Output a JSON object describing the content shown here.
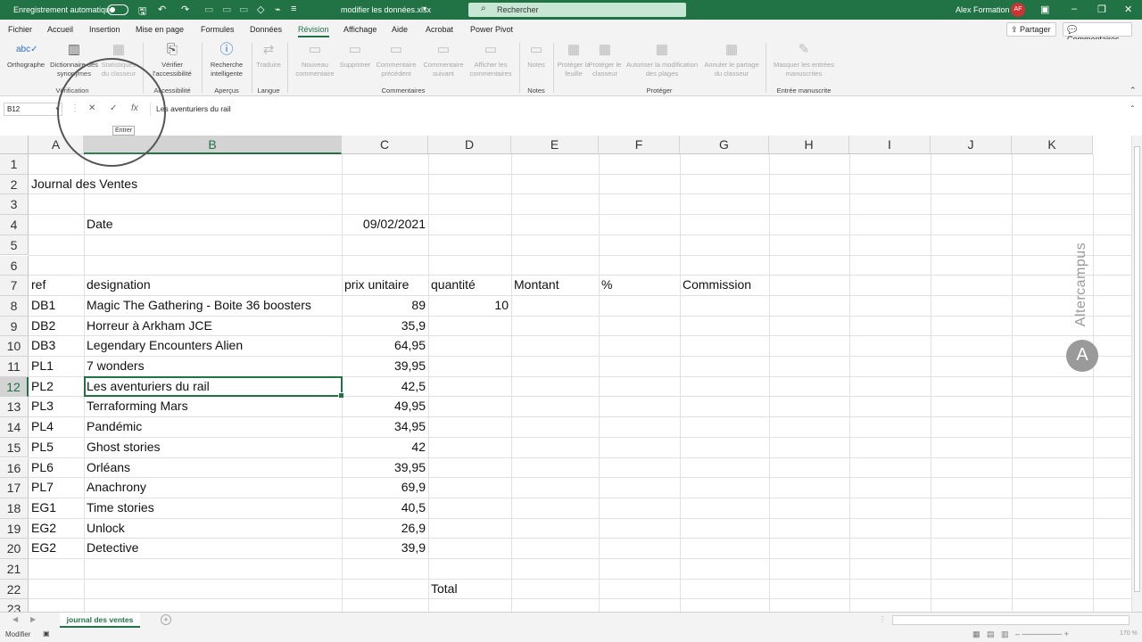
{
  "titlebar": {
    "autosave_label": "Enregistrement automatique",
    "filename": "modifier les données.xlsx",
    "search_placeholder": "Rechercher",
    "user_name": "Alex Formation",
    "user_initials": "AF"
  },
  "menu": {
    "tabs": [
      "Fichier",
      "Accueil",
      "Insertion",
      "Mise en page",
      "Formules",
      "Données",
      "Révision",
      "Affichage",
      "Aide",
      "Acrobat",
      "Power Pivot"
    ],
    "active_tab": "Révision",
    "share_label": "Partager",
    "comments_label": "Commentaires"
  },
  "ribbon": {
    "buttons": {
      "orthographe": "Orthographe",
      "dictionnaire": "Dictionnaire des synonymes",
      "statistiques": "Statistiques du classeur",
      "verifier": "Vérifier l'accessibilité",
      "recherche": "Recherche intelligente",
      "traduire": "Traduire",
      "nouveau_comm": "Nouveau commentaire",
      "supprimer": "Supprimer",
      "comm_precedent": "Commentaire précédent",
      "comm_suivant": "Commentaire suivant",
      "afficher_comm": "Afficher les commentaires",
      "notes": "Notes",
      "proteger_feuille": "Protéger la feuille",
      "proteger_classeur": "Protéger le classeur",
      "autoriser": "Autoriser la modification des plages",
      "annuler_partage": "Annuler le partage du classeur",
      "masquer": "Masquer les entrées manuscrites"
    },
    "groups": {
      "verification": "Vérification",
      "accessibilite": "Accessibilité",
      "apercus": "Aperçus",
      "langue": "Langue",
      "commentaires": "Commentaires",
      "notes": "Notes",
      "proteger": "Protéger",
      "entree_manuscrite": "Entrée manuscrite"
    }
  },
  "formula_bar": {
    "name_box": "B12",
    "content": "Les aventuriers du rail",
    "tooltip": "Entrer"
  },
  "grid": {
    "columns": [
      "A",
      "B",
      "C",
      "D",
      "E",
      "F",
      "G",
      "H",
      "I",
      "J",
      "K"
    ],
    "rows": [
      "1",
      "2",
      "3",
      "4",
      "5",
      "6",
      "7",
      "8",
      "9",
      "10",
      "11",
      "12",
      "13",
      "14",
      "15",
      "16",
      "17",
      "18",
      "19",
      "20",
      "21",
      "22",
      "23"
    ],
    "title": "Journal des Ventes",
    "date_label": "Date",
    "date_value": "09/02/2021",
    "headers": {
      "ref": "ref",
      "designation": "designation",
      "prix": "prix unitaire",
      "quantite": "quantité",
      "montant": "Montant",
      "pct": "%",
      "commission": "Commission"
    },
    "items": [
      {
        "ref": "DB1",
        "designation": "Magic The Gathering - Boite 36 boosters",
        "prix": "89",
        "quantite": "10"
      },
      {
        "ref": "DB2",
        "designation": "Horreur à Arkham JCE",
        "prix": "35,9",
        "quantite": ""
      },
      {
        "ref": "DB3",
        "designation": "Legendary Encounters Alien",
        "prix": "64,95",
        "quantite": ""
      },
      {
        "ref": "PL1",
        "designation": "7 wonders",
        "prix": "39,95",
        "quantite": ""
      },
      {
        "ref": "PL2",
        "designation": "Les aventuriers du rail",
        "prix": "42,5",
        "quantite": ""
      },
      {
        "ref": "PL3",
        "designation": "Terraforming Mars",
        "prix": "49,95",
        "quantite": ""
      },
      {
        "ref": "PL4",
        "designation": "Pandémic",
        "prix": "34,95",
        "quantite": ""
      },
      {
        "ref": "PL5",
        "designation": "Ghost stories",
        "prix": "42",
        "quantite": ""
      },
      {
        "ref": "PL6",
        "designation": "Orléans",
        "prix": "39,95",
        "quantite": ""
      },
      {
        "ref": "PL7",
        "designation": "Anachrony",
        "prix": "69,9",
        "quantite": ""
      },
      {
        "ref": "EG1",
        "designation": "Time stories",
        "prix": "40,5",
        "quantite": ""
      },
      {
        "ref": "EG2",
        "designation": "Unlock",
        "prix": "26,9",
        "quantite": ""
      },
      {
        "ref": "EG2",
        "designation": "Detective",
        "prix": "39,9",
        "quantite": ""
      }
    ],
    "total_label": "Total"
  },
  "watermark": {
    "text": "Altercampus"
  },
  "sheets": {
    "active": "journal des ventes"
  },
  "status": {
    "mode": "Modifier",
    "zoom": "170 %"
  },
  "colors": {
    "excel_green": "#217346"
  }
}
